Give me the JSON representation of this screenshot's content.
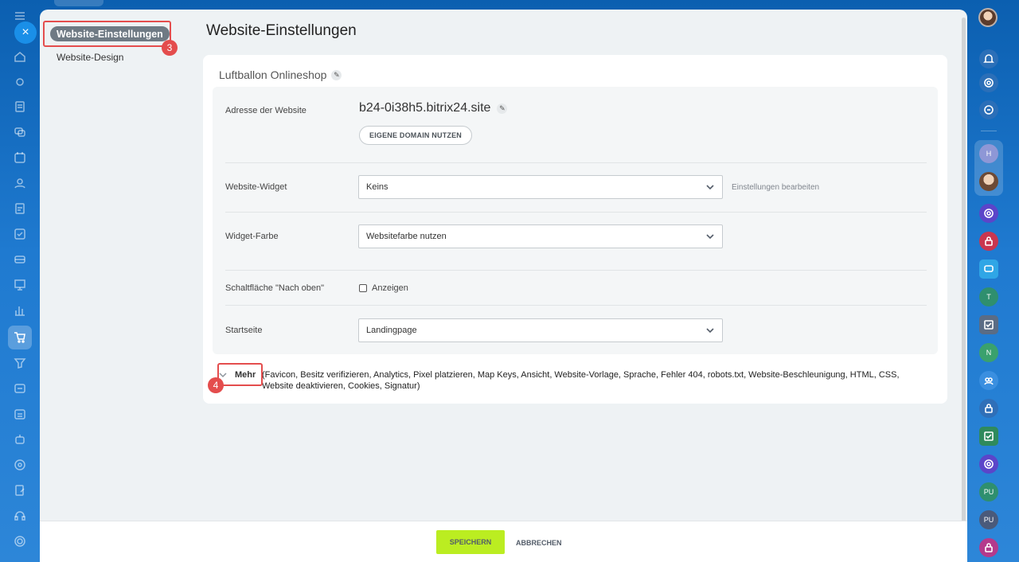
{
  "left_rail": {
    "close_label": "×",
    "icons": [
      "menu-icon",
      "home-icon",
      "puzzle-icon",
      "document-icon",
      "chat-icon",
      "calendar-icon",
      "contacts-icon",
      "file-icon",
      "checkbox-icon",
      "card-icon",
      "presentation-icon",
      "chart-icon",
      "cart-icon",
      "funnel-icon",
      "media-icon",
      "calendar-grid-icon",
      "robot-icon",
      "target-icon",
      "edit-doc-icon",
      "headset-icon",
      "settings-icon"
    ]
  },
  "right_rail": {
    "icons": [
      "bell-icon",
      "target-icon",
      "search-chat-icon"
    ],
    "chat_badges": [
      "H",
      "T",
      "N",
      "PU",
      "PU"
    ]
  },
  "side_nav": {
    "active": "Website-Einstellungen",
    "items": [
      "Website-Design"
    ],
    "step_badge": "3"
  },
  "page": {
    "title": "Website-Einstellungen",
    "site_name": "Luftballon Onlineshop"
  },
  "form": {
    "address_label": "Adresse der Website",
    "address_value": "b24-0i38h5.bitrix24.site",
    "domain_button": "EIGENE DOMAIN NUTZEN",
    "widget_label": "Website-Widget",
    "widget_value": "Keins",
    "widget_edit_link": "Einstellungen bearbeiten",
    "color_label": "Widget-Farbe",
    "color_value": "Websitefarbe nutzen",
    "top_button_label": "Schaltfläche \"Nach oben\"",
    "top_button_checkbox": "Anzeigen",
    "start_label": "Startseite",
    "start_value": "Landingpage"
  },
  "more": {
    "label": "Mehr",
    "list": "(Favicon,  Besitz verifizieren,  Analytics,  Pixel platzieren,  Map Keys,  Ansicht,  Website-Vorlage,  Sprache,  Fehler 404,  robots.txt,  Website-Beschleunigung,  HTML,  CSS,  Website deaktivieren,  Cookies,  Signatur)",
    "step_badge": "4"
  },
  "footer": {
    "save": "SPEICHERN",
    "cancel": "ABBRECHEN"
  },
  "colors": {
    "accent_green": "#bbed21",
    "highlight_red": "#e44d4d",
    "nav_active_bg": "#6f7a84",
    "background_blue": "#1f7ad0"
  }
}
